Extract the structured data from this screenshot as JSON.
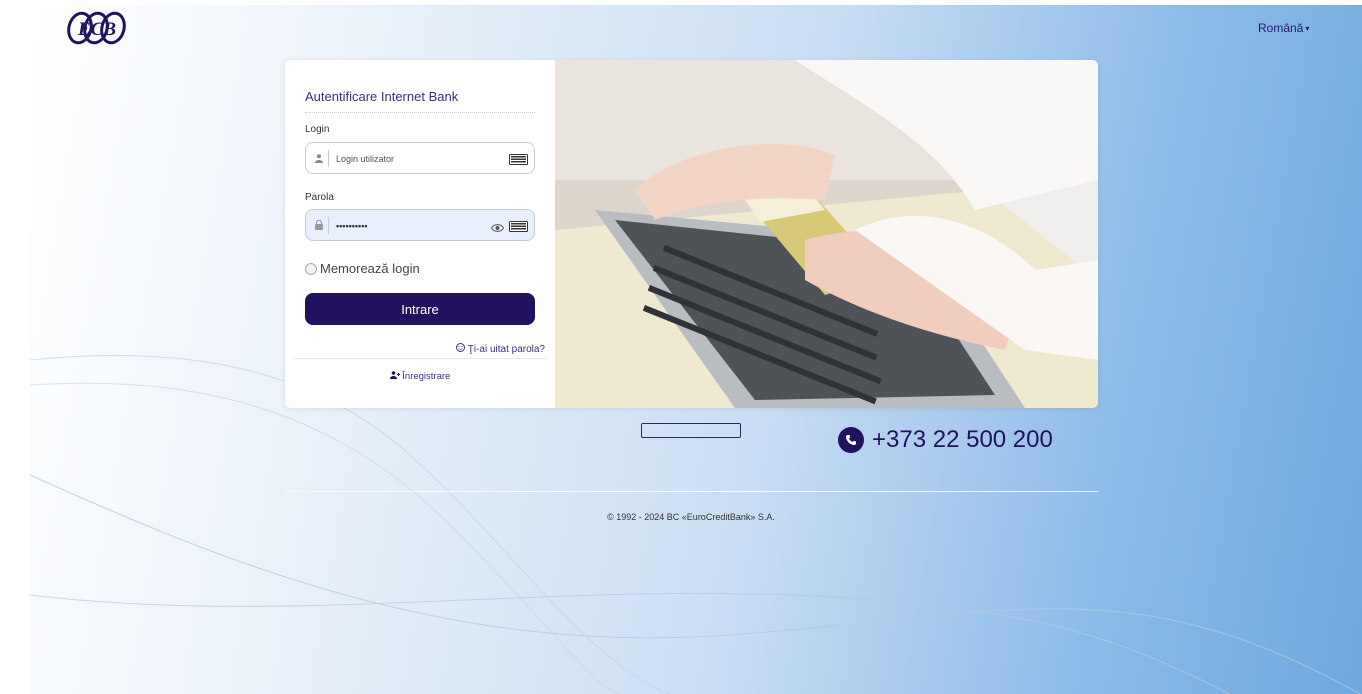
{
  "header": {
    "logo_text": "ECB",
    "language": "Română"
  },
  "login_form": {
    "title": "Autentificare Internet Bank",
    "login_label": "Login",
    "login_placeholder": "Login utilizator",
    "password_label": "Parola",
    "password_value": "••••••••••",
    "remember_label": "Memorează login",
    "submit_label": "Intrare",
    "forgot_label": "Ţi-ai uitat parola?",
    "register_label": "Înregistrare"
  },
  "contact": {
    "phone": "+373 22 500 200"
  },
  "footer": {
    "copyright": "© 1992 - 2024 BC «EuroCreditBank» S.A."
  },
  "colors": {
    "brand": "#22115e",
    "accent_text": "#3a2f86"
  },
  "icons": [
    "user-icon",
    "lock-icon",
    "keyboard-icon",
    "eye-icon",
    "question-icon",
    "user-plus-icon",
    "phone-icon",
    "caret-down-icon"
  ]
}
